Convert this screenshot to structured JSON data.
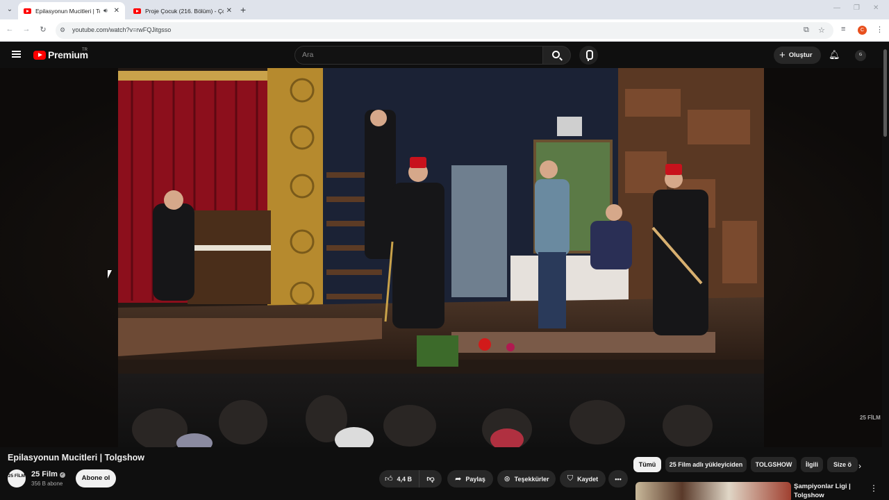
{
  "browser": {
    "tabs": [
      {
        "title": "Epilasyonun Mucitleri | Tolg",
        "active": true,
        "audio": true
      },
      {
        "title": "Proje Çocuk (216. Bölüm) - Çoc",
        "active": false,
        "audio": false
      }
    ],
    "url": "youtube.com/watch?v=rwFQJitgsso",
    "profile_initial": "C"
  },
  "header": {
    "logo_text": "Premium",
    "region": "TR",
    "search_placeholder": "Ara",
    "create_label": "Oluştur"
  },
  "video": {
    "title": "Epilasyonun Mucitleri | Tolgshow",
    "watermark": "25 FİLM"
  },
  "channel": {
    "avatar_text": "25 FİLM",
    "name": "25 Film",
    "subscribers": "356 B abone",
    "subscribe_label": "Abone ol"
  },
  "actions": {
    "likes": "4,4 B",
    "share": "Paylaş",
    "thanks": "Teşekkürler",
    "save": "Kaydet"
  },
  "chips": [
    "Tümü",
    "25 Film adlı yükleyiciden",
    "TOLGSHOW",
    "İlgili",
    "Size ö"
  ],
  "recommendation": {
    "title": "Şampiyonlar Ligi | Tolgshow"
  },
  "colors": {
    "yt_red": "#ff0000",
    "background": "#0f0f0f",
    "chip_bg": "#272727"
  }
}
